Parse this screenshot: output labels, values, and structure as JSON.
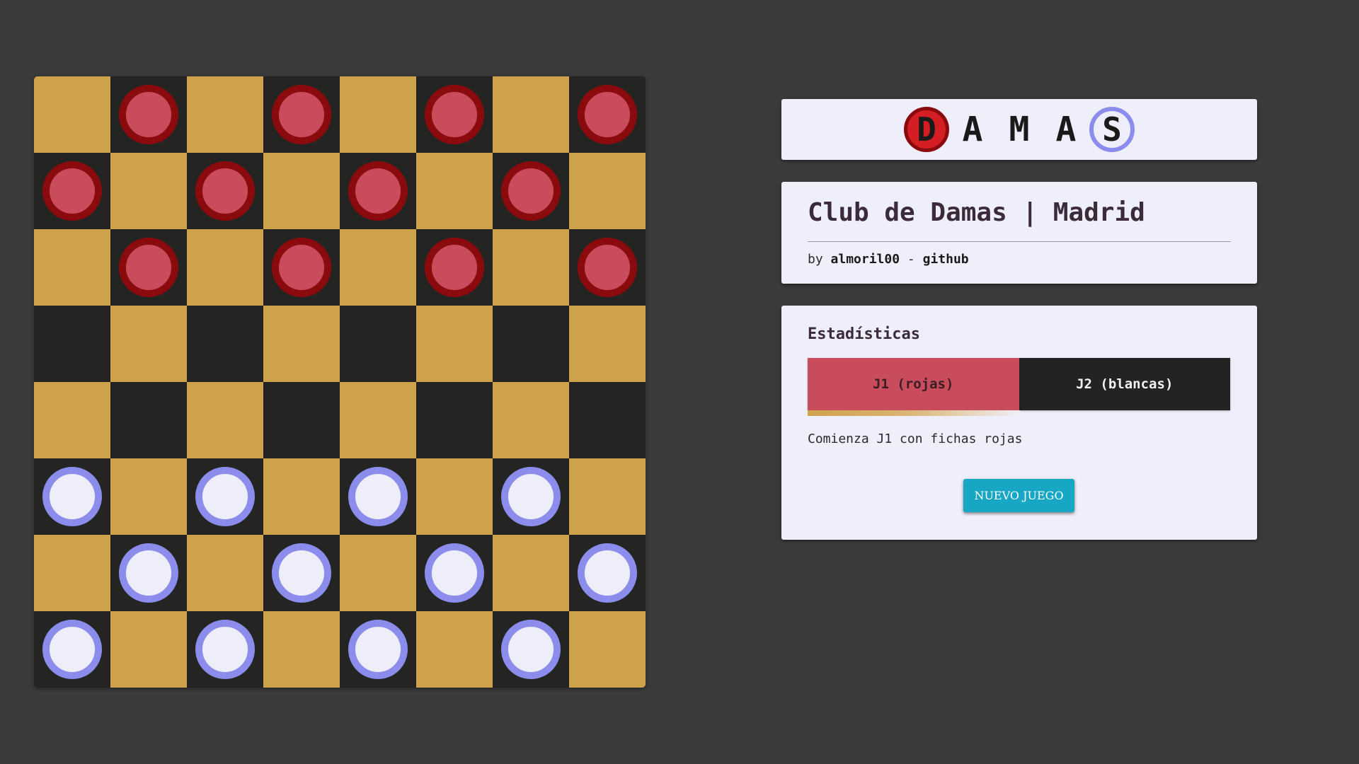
{
  "board": {
    "size": 8,
    "light_color": "#cfa24c",
    "dark_color": "#242522",
    "pieces": [
      [
        "",
        "red",
        "",
        "red",
        "",
        "red",
        "",
        "red"
      ],
      [
        "red",
        "",
        "red",
        "",
        "red",
        "",
        "red",
        ""
      ],
      [
        "",
        "red",
        "",
        "red",
        "",
        "red",
        "",
        "red"
      ],
      [
        "",
        "",
        "",
        "",
        "",
        "",
        "",
        ""
      ],
      [
        "",
        "",
        "",
        "",
        "",
        "",
        "",
        ""
      ],
      [
        "white",
        "",
        "white",
        "",
        "white",
        "",
        "white",
        ""
      ],
      [
        "",
        "white",
        "",
        "white",
        "",
        "white",
        "",
        "white"
      ],
      [
        "white",
        "",
        "white",
        "",
        "white",
        "",
        "white",
        ""
      ]
    ],
    "piece_colors": {
      "red": {
        "fill": "#c84c5c",
        "ring": "#8b0a0e"
      },
      "white": {
        "fill": "#eeeefa",
        "ring": "#8c8ced"
      }
    }
  },
  "logo": {
    "first": "D",
    "middle": [
      "A",
      "M",
      "A"
    ],
    "last": "S"
  },
  "header": {
    "title": "Club de Damas | Madrid",
    "by_prefix": "by",
    "author": "almoril00",
    "separator": "-",
    "link": "github"
  },
  "stats": {
    "heading": "Estadísticas",
    "player1_label": "J1 (rojas)",
    "player2_label": "J2 (blancas)",
    "active_player": 1,
    "status": "Comienza J1 con fichas rojas",
    "new_game_label": "NUEVO JUEGO"
  },
  "colors": {
    "background": "#3a3a3a",
    "panel": "#efeffb",
    "player1": "#c84c5c",
    "player2": "#222421",
    "button": "#17a6c3"
  }
}
